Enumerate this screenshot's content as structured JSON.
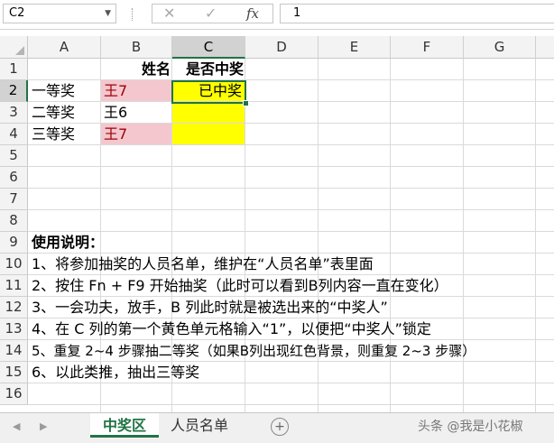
{
  "formula_bar": {
    "name_box": "C2",
    "cancel_icon": "✕",
    "enter_icon": "✓",
    "fx_label": "fx",
    "value": "1"
  },
  "columns": [
    "A",
    "B",
    "C",
    "D",
    "E",
    "F",
    "G"
  ],
  "rows": [
    "1",
    "2",
    "3",
    "4",
    "5",
    "6",
    "7",
    "8",
    "9",
    "10",
    "11",
    "12",
    "13",
    "14",
    "15",
    "16"
  ],
  "cells": {
    "B1": "姓名",
    "C1": "是否中奖",
    "A2": "一等奖",
    "B2": "王7",
    "C2": "已中奖",
    "A3": "二等奖",
    "B3": "王6",
    "A4": "三等奖",
    "B4": "王7",
    "A9": "使用说明：",
    "A10": "1、将参加抽奖的人员名单，维护在“人员名单”表里面",
    "A11": "2、按住 Fn + F9 开始抽奖（此时可以看到B列内容一直在变化）",
    "A12": "3、一会功夫，放手，B 列此时就是被选出来的“中奖人”",
    "A13": "4、在 C 列的第一个黄色单元格输入“1”，以便把“中奖人”锁定",
    "A14": "5、重复 2~4 步骤抽二等奖（如果B列出现红色背景，则重复 2~3 步骤）",
    "A15": "6、以此类推，抽出三等奖"
  },
  "colors": {
    "duplicate_fill": "#f4c7ce",
    "highlight_fill": "#ffff00",
    "excel_green": "#217346"
  },
  "sheet_tabs": {
    "nav_prev": "◀",
    "nav_next": "▶",
    "tabs": [
      "中奖区",
      "人员名单"
    ],
    "active": "中奖区",
    "add_label": "+"
  },
  "watermark": "头条 @我是小花椒"
}
